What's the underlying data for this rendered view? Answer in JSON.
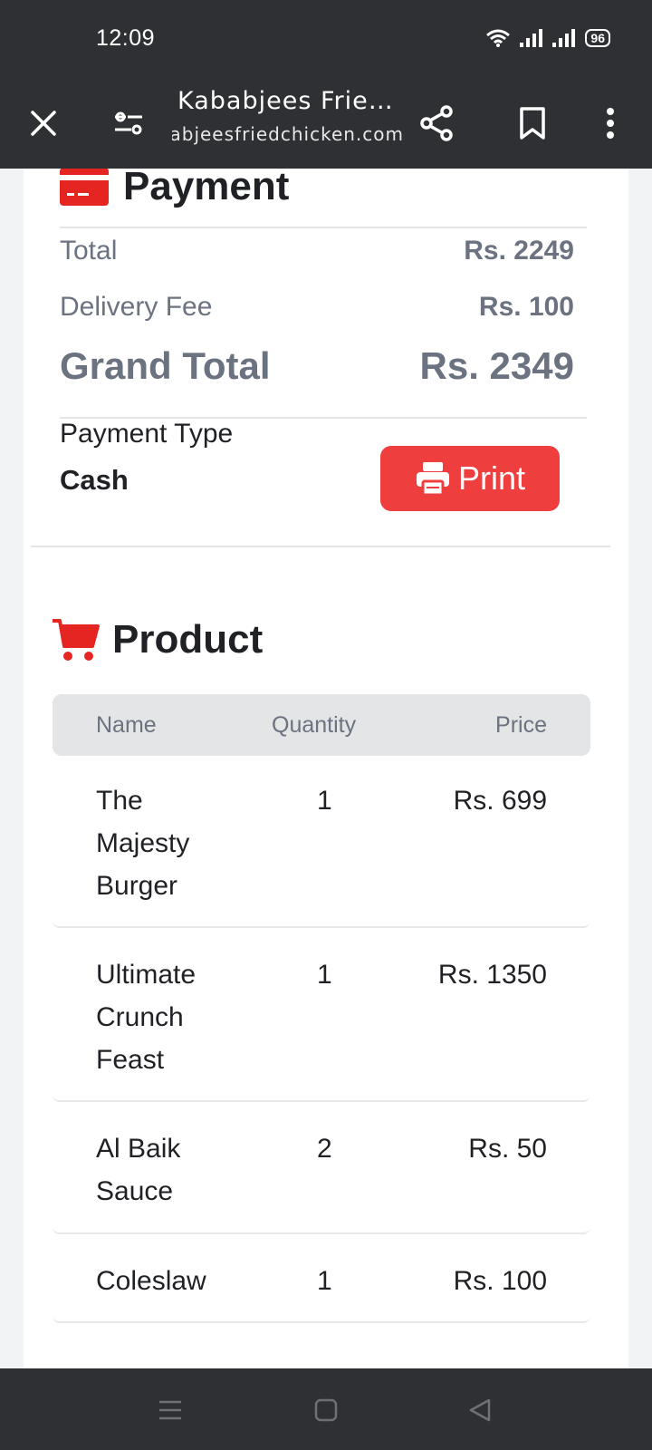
{
  "status_bar": {
    "time": "12:09",
    "battery": "96"
  },
  "browser": {
    "title": "Kababjees Fried...",
    "url": "kababjeesfriedchicken.com",
    "icons": [
      "close-icon",
      "tune-icon",
      "share-icon",
      "bookmark-icon",
      "more-vert-icon"
    ]
  },
  "payment": {
    "heading": "Payment",
    "icon": "credit-card-icon",
    "total_label": "Total",
    "total_value": "Rs. 2249",
    "delivery_label": "Delivery Fee",
    "delivery_value": "Rs. 100",
    "grand_label": "Grand Total",
    "grand_value": "Rs. 2349",
    "type_label": "Payment Type",
    "type_value": "Cash",
    "print_label": "Print",
    "print_icon": "printer-icon"
  },
  "product": {
    "heading": "Product",
    "icon": "cart-icon",
    "columns": [
      "Name",
      "Quantity",
      "Price"
    ],
    "rows": [
      {
        "name": "The Majesty Burger",
        "quantity": "1",
        "price": "Rs. 699"
      },
      {
        "name": "Ultimate Crunch Feast",
        "quantity": "1",
        "price": "Rs. 1350"
      },
      {
        "name": "Al Baik Sauce",
        "quantity": "2",
        "price": "Rs. 50"
      },
      {
        "name": "Coleslaw",
        "quantity": "1",
        "price": "Rs. 100"
      }
    ]
  },
  "colors": {
    "accent": "#ef3e3e",
    "bar": "#2f3033",
    "muted": "#6b7280"
  },
  "nav": {
    "icons": [
      "menu-icon",
      "home-square-icon",
      "back-triangle-icon"
    ]
  }
}
